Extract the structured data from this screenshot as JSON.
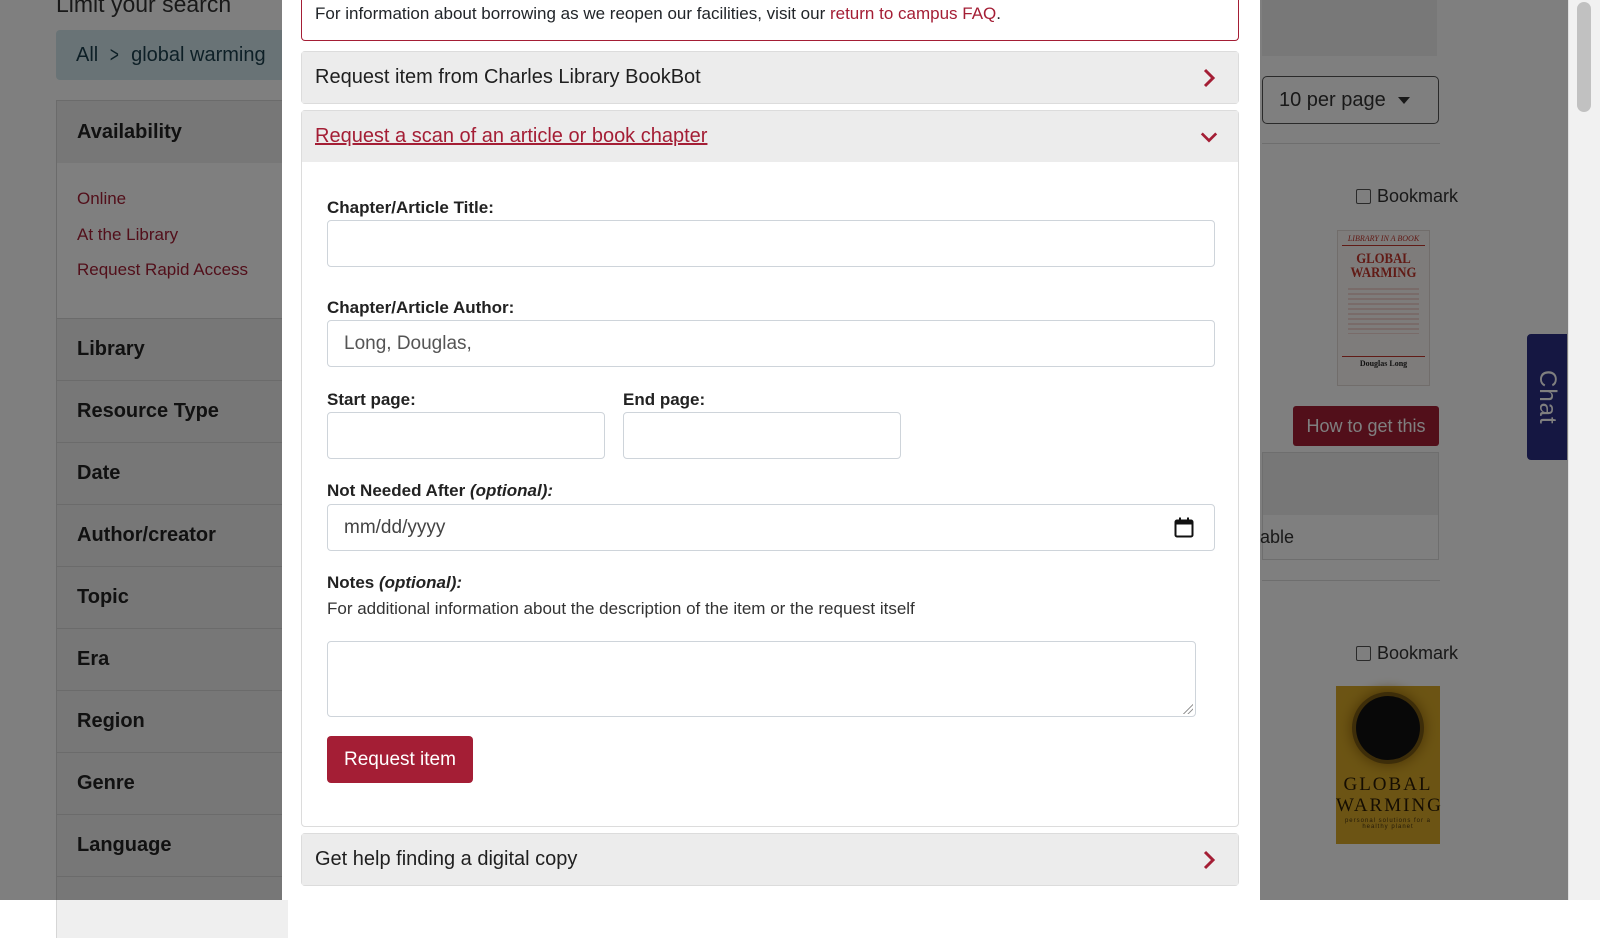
{
  "background": {
    "limit_title": "Limit your search",
    "breadcrumb": {
      "root": "All",
      "current": "global warming"
    },
    "facets": {
      "availability": {
        "label": "Availability",
        "items": [
          "Online",
          "At the Library",
          "Request Rapid Access"
        ]
      },
      "collapsed": [
        "Library",
        "Resource Type",
        "Date",
        "Author/creator",
        "Topic",
        "Era",
        "Region",
        "Genre",
        "Language"
      ]
    },
    "per_page": "10 per page",
    "results": [
      {
        "bookmark_label": "Bookmark",
        "cover": {
          "series": "LIBRARY IN A BOOK",
          "title": "GLOBAL WARMING",
          "author": "Douglas Long"
        },
        "action_button": "How to get this",
        "availability_fragment": "able"
      },
      {
        "bookmark_label": "Bookmark",
        "cover": {
          "title_line1": "GLOBAL",
          "title_line2": "WARMING",
          "subtitle": "personal solutions for a healthy planet"
        }
      }
    ],
    "chat_label": "Chat"
  },
  "modal": {
    "notice": {
      "text": "For information about borrowing as we reopen our facilities, visit our ",
      "link": "return to campus FAQ",
      "end": "."
    },
    "sections": {
      "bookbot": "Request item from Charles Library BookBot",
      "scan": "Request a scan of an article or book chapter",
      "digital": "Get help finding a digital copy"
    },
    "form": {
      "title_label": "Chapter/Article Title:",
      "title_value": "",
      "author_label": "Chapter/Article Author:",
      "author_value": "Long, Douglas,",
      "start_label": "Start page:",
      "end_label": "End page:",
      "not_needed_label": "Not Needed After ",
      "not_needed_optional": "(optional):",
      "date_placeholder": "mm/dd/yyyy",
      "notes_label": "Notes ",
      "notes_optional": "(optional):",
      "notes_help": "For additional information about the description of the item or the request itself",
      "submit": "Request item"
    }
  },
  "colors": {
    "brand": "#a41e35",
    "overlay": "rgba(0,0,0,0.5)",
    "chat": "#2b2e84"
  }
}
